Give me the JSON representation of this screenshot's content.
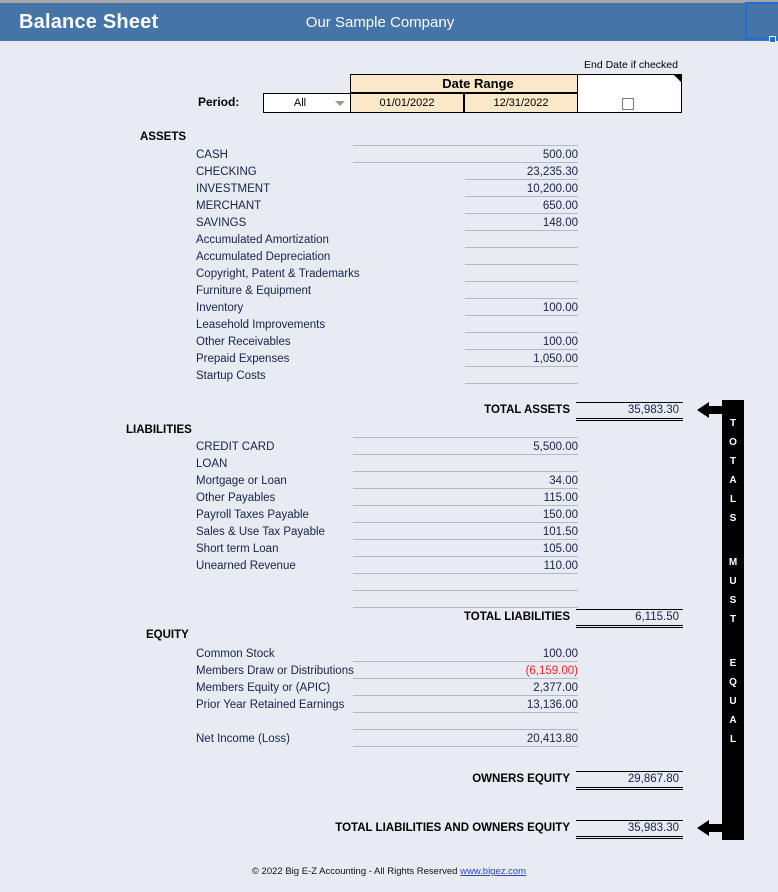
{
  "header": {
    "title": "Balance Sheet",
    "company": "Our Sample Company",
    "band_color": "#4574a8"
  },
  "controls": {
    "end_date_caption": "End Date if checked",
    "period_label": "Period:",
    "period_value": "All",
    "date_range_header": "Date Range",
    "date_from": "01/01/2022",
    "date_to": "12/31/2022",
    "checkbox_checked": false
  },
  "assets": {
    "heading": "ASSETS",
    "rows": [
      {
        "label": "CASH",
        "value": "500.00"
      },
      {
        "label": "CHECKING",
        "value": "23,235.30"
      },
      {
        "label": "INVESTMENT",
        "value": "10,200.00"
      },
      {
        "label": "MERCHANT",
        "value": "650.00"
      },
      {
        "label": "SAVINGS",
        "value": "148.00"
      },
      {
        "label": "Accumulated Amortization",
        "value": ""
      },
      {
        "label": "Accumulated Depreciation",
        "value": ""
      },
      {
        "label": "Copyright, Patent & Trademarks",
        "value": ""
      },
      {
        "label": "Furniture & Equipment",
        "value": ""
      },
      {
        "label": "Inventory",
        "value": "100.00"
      },
      {
        "label": "Leasehold Improvements",
        "value": ""
      },
      {
        "label": "Other Receivables",
        "value": "100.00"
      },
      {
        "label": "Prepaid Expenses",
        "value": "1,050.00"
      },
      {
        "label": "Startup Costs",
        "value": ""
      }
    ],
    "total_label": "TOTAL ASSETS",
    "total_value": "35,983.30"
  },
  "liabilities": {
    "heading": "LIABILITIES",
    "rows": [
      {
        "label": "CREDIT CARD",
        "value": "5,500.00"
      },
      {
        "label": "LOAN",
        "value": ""
      },
      {
        "label": "Mortgage or Loan",
        "value": "34.00"
      },
      {
        "label": "Other Payables",
        "value": "115.00"
      },
      {
        "label": "Payroll Taxes Payable",
        "value": "150.00"
      },
      {
        "label": "Sales & Use Tax Payable",
        "value": "101.50"
      },
      {
        "label": "Short term Loan",
        "value": "105.00"
      },
      {
        "label": "Unearned Revenue",
        "value": "110.00"
      },
      {
        "label": "",
        "value": ""
      },
      {
        "label": "",
        "value": ""
      }
    ],
    "total_label": "TOTAL LIABILITIES",
    "total_value": "6,115.50"
  },
  "equity": {
    "heading": "EQUITY",
    "rows": [
      {
        "label": "Common Stock",
        "value": "100.00",
        "negative": false
      },
      {
        "label": "Members Draw or Distributions",
        "value": "(6,159.00)",
        "negative": true
      },
      {
        "label": "Members Equity or (APIC)",
        "value": "2,377.00",
        "negative": false
      },
      {
        "label": "Prior Year Retained Earnings",
        "value": "13,136.00",
        "negative": false
      },
      {
        "label": "",
        "value": "",
        "negative": false
      },
      {
        "label": "Net Income (Loss)",
        "value": "20,413.80",
        "negative": false
      }
    ],
    "total_label": "OWNERS EQUITY",
    "total_value": "29,867.80"
  },
  "grand_total": {
    "label": "TOTAL LIABILITIES AND OWNERS EQUITY",
    "value": "35,983.30"
  },
  "equal_bar": {
    "lines": [
      "TOTALS",
      "MUST",
      "EQUAL"
    ],
    "color": "#000000"
  },
  "footer": {
    "text": "© 2022 Big E-Z Accounting -  All Rights Reserved ",
    "link": "www.bigez.com"
  }
}
